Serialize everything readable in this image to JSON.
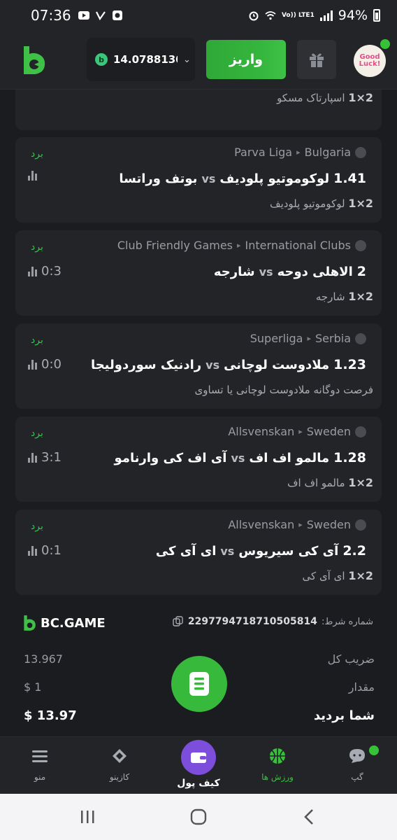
{
  "status_bar": {
    "time": "07:36",
    "network": "Vo)) LTE1",
    "battery": "94%"
  },
  "header": {
    "balance": "14.0788130",
    "deposit_label": "واریز",
    "avatar_text": "Good Luck!"
  },
  "partial_card": {
    "pick": "اسپارتاک مسکو",
    "pick_prefix": "2×1"
  },
  "cards": [
    {
      "status": "برد",
      "league": "Parva Liga",
      "country": "Bulgaria",
      "odds": "1.41",
      "home": "لوکوموتیو پلودیف",
      "vs": "vs",
      "away": "بوتف وراتسا",
      "score": "",
      "pick_prefix": "2×1",
      "pick": "لوکوموتیو پلودیف"
    },
    {
      "status": "برد",
      "league": "Club Friendly Games",
      "country": "International Clubs",
      "odds": "2",
      "home": "الاهلی دوحه",
      "vs": "vs",
      "away": "شارجه",
      "score": "0:3",
      "pick_prefix": "2×1",
      "pick": "شارجه"
    },
    {
      "status": "برد",
      "league": "Superliga",
      "country": "Serbia",
      "odds": "1.23",
      "home": "ملادوست لوچانی",
      "vs": "vs",
      "away": "رادنیک سوردولیجا",
      "score": "0:0",
      "pick_prefix": "",
      "pick": "فرصت دوگانه ملادوست لوچانی یا تساوی"
    },
    {
      "status": "برد",
      "league": "Allsvenskan",
      "country": "Sweden",
      "odds": "1.28",
      "home": "مالمو اف اف",
      "vs": "vs",
      "away": "آی اف کی وارنامو",
      "score": "3:1",
      "pick_prefix": "2×1",
      "pick": "مالمو اف اف"
    },
    {
      "status": "برد",
      "league": "Allsvenskan",
      "country": "Sweden",
      "odds": "2.2",
      "home": "آی کی سیریوس",
      "vs": "vs",
      "away": "ای آی کی",
      "score": "0:1",
      "pick_prefix": "2×1",
      "pick": "ای آی کی"
    }
  ],
  "summary": {
    "brand": "BC.GAME",
    "bet_id_label": "شماره شرط:",
    "bet_id": "2297794718710505814",
    "total_odds_label": "ضریب کل",
    "total_odds": "13.967",
    "amount_label": "مقدار",
    "amount": "$ 1",
    "win_label": "شما بردید",
    "win": "$ 13.97"
  },
  "bottom_nav": {
    "menu": "منو",
    "casino": "کازینو",
    "wallet": "کیف پول",
    "sports": "ورزش ها",
    "chat": "گپ"
  },
  "colors": {
    "accent": "#37b93c",
    "win_text": "#33c24d",
    "wallet_purple": "#7d4ddb",
    "background": "#1b1c1f",
    "card": "#232428"
  }
}
